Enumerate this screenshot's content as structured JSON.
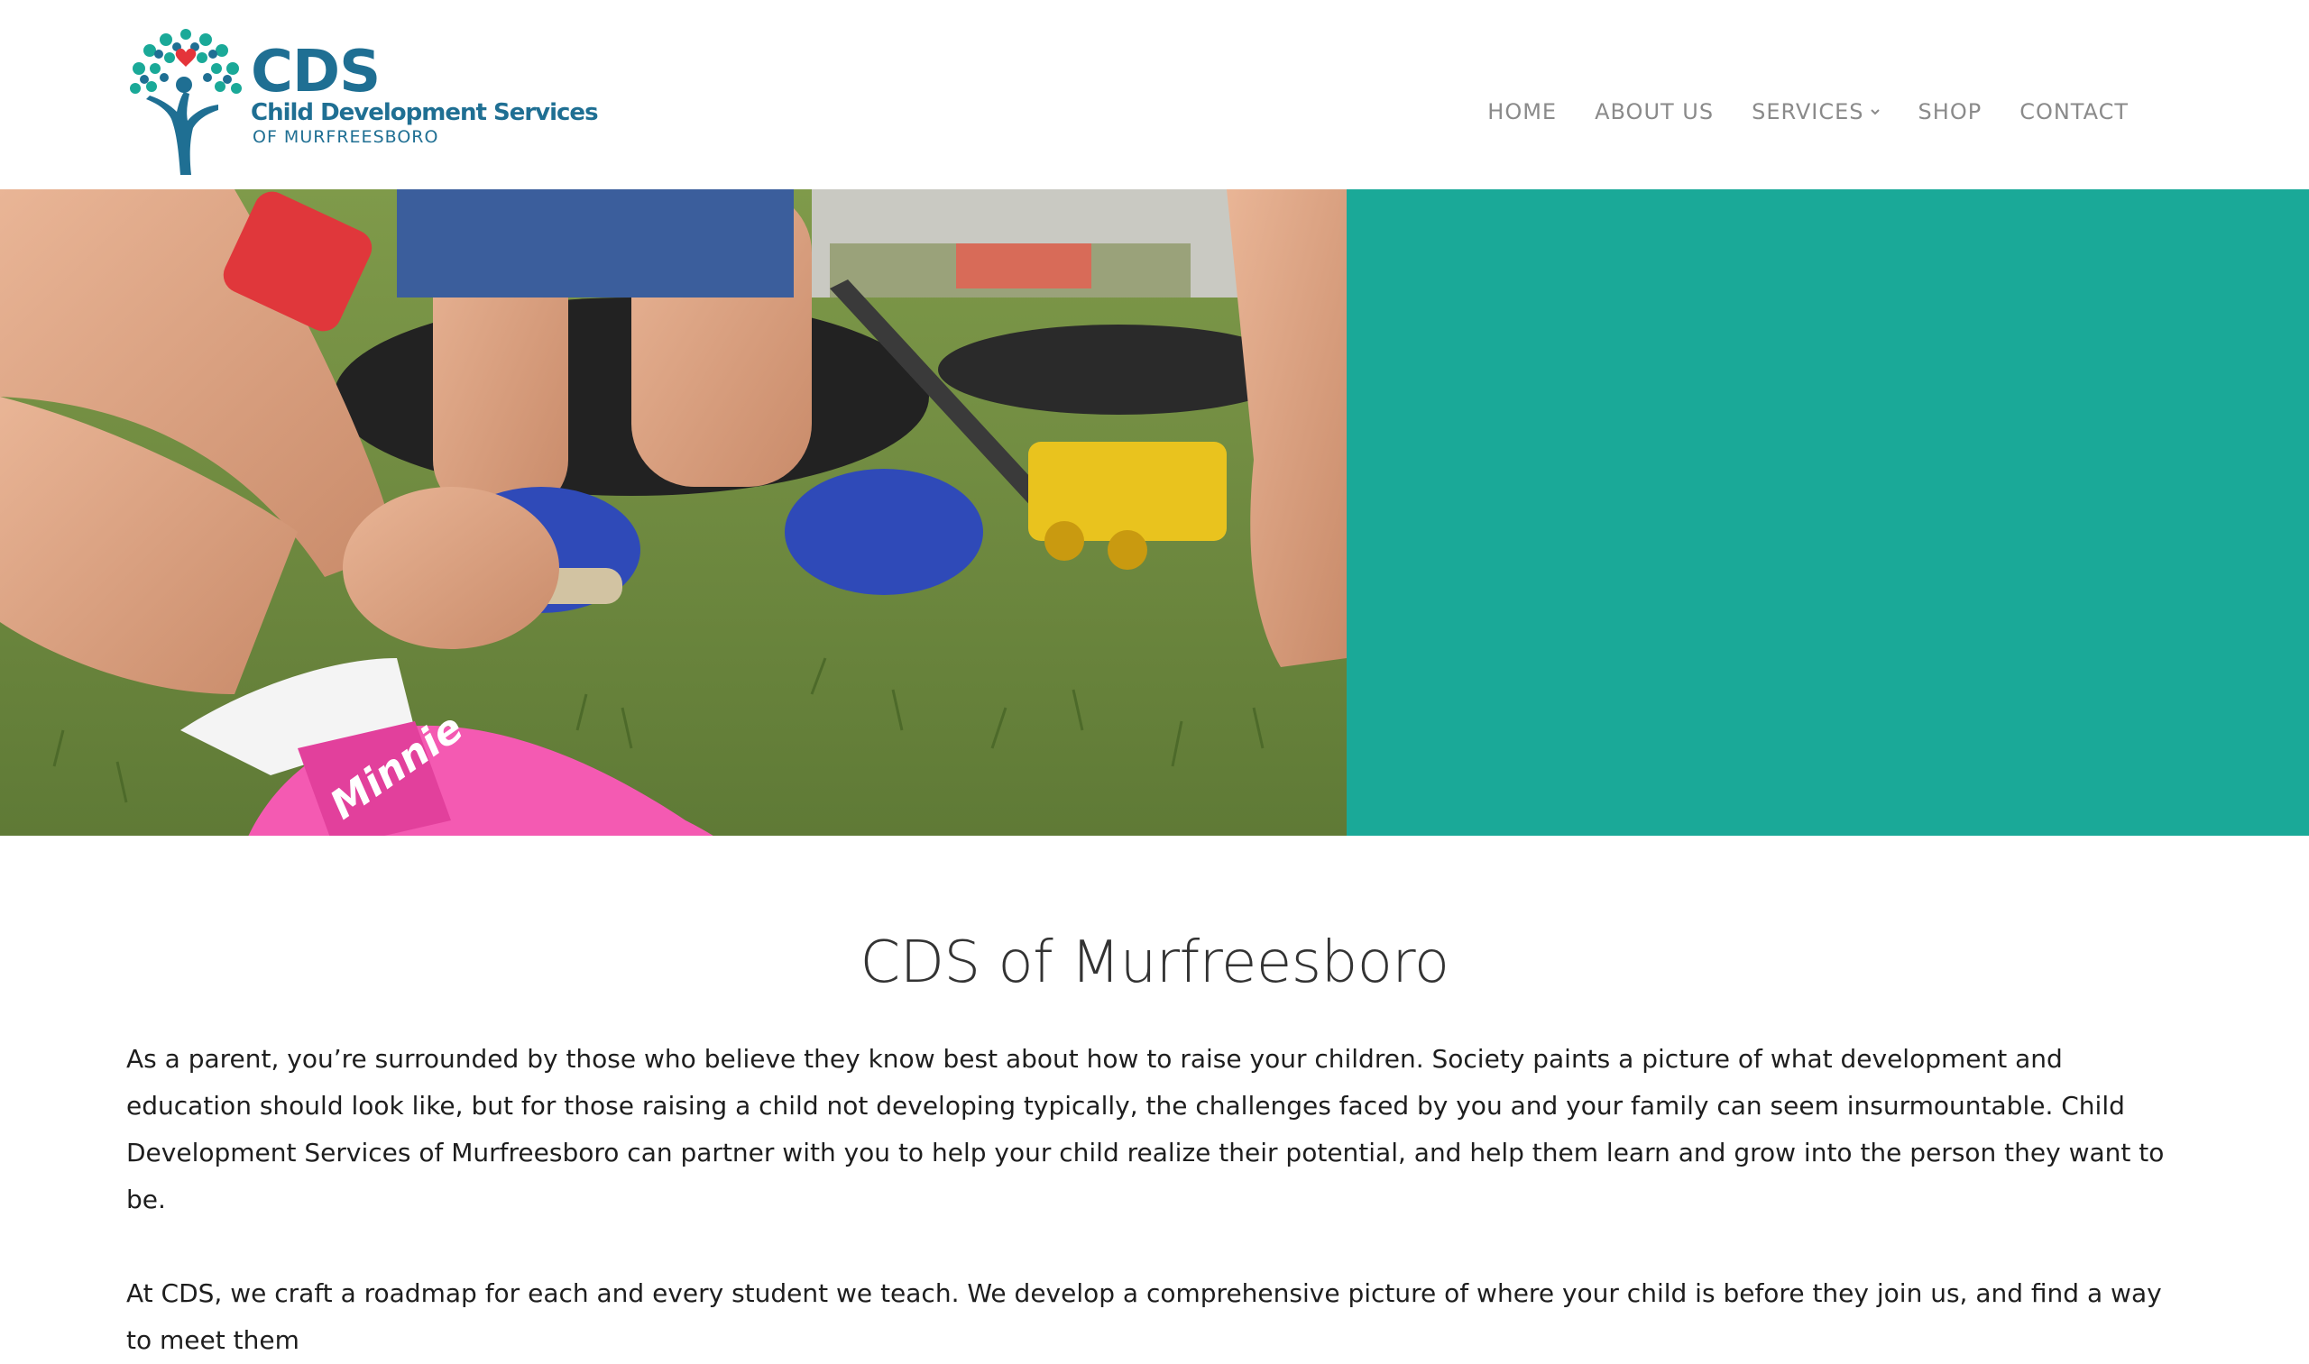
{
  "logo": {
    "cds": "CDS",
    "line1": "Child Development Services",
    "line2": "OF MURFREESBORO"
  },
  "nav": {
    "items": [
      {
        "label": "HOME"
      },
      {
        "label": "ABOUT US"
      },
      {
        "label": "SERVICES",
        "has_dropdown": true
      },
      {
        "label": "SHOP"
      },
      {
        "label": "CONTACT"
      }
    ]
  },
  "hero": {
    "accent_color": "#1aa998",
    "shoe_label_pink": "Minnie"
  },
  "main": {
    "title": "CDS of Murfreesboro",
    "paragraphs": [
      "As a parent, you’re surrounded by those who believe they know best about how to raise your children. Society paints a picture of what development and education should look like, but for those raising a child not developing typically, the challenges faced by you and your family can seem insurmountable. Child Development Services of Murfreesboro can partner with you to help your child realize their potential, and help them learn and grow into the person they want to be.",
      "At CDS, we craft a roadmap for each and every student we teach. We develop a comprehensive picture of where your child is before they join us, and find a way to meet them"
    ]
  },
  "colors": {
    "brand_blue": "#1f6f93",
    "brand_teal": "#1aa998",
    "nav_text": "#8a8a8a",
    "body_text": "#1e1e1e"
  }
}
